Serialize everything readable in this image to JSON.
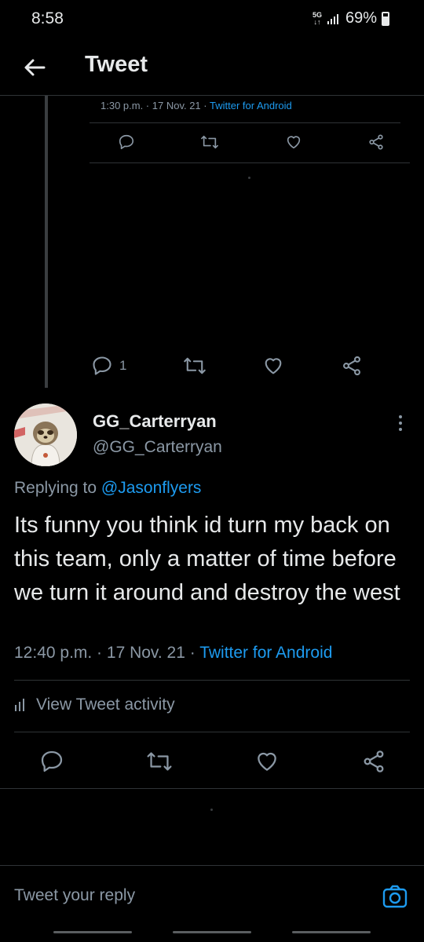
{
  "status_bar": {
    "time": "8:58",
    "network_top": "5G",
    "network_bottom": "↓↑",
    "battery": "69%"
  },
  "header": {
    "back_icon": "back-arrow-icon",
    "title": "Tweet"
  },
  "quoted_tweet": {
    "meta_prefix": "1:30 p.m. · 17 Nov. 21 · ",
    "source": "Twitter for Android",
    "actions": [
      "reply-icon",
      "retweet-icon",
      "like-icon",
      "share-icon"
    ]
  },
  "parent_actions": {
    "reply_count": "1",
    "icons": [
      "reply-icon",
      "retweet-icon",
      "like-icon",
      "share-icon"
    ]
  },
  "main_tweet": {
    "display_name": "GG_Carterryan",
    "handle": "@GG_Carterryan",
    "replying_prefix": "Replying to ",
    "replying_to": "@Jasonflyers",
    "text": "Its funny you think id turn my back on this team, only a matter of time before we turn it around and destroy the west",
    "meta_prefix": "12:40 p.m. · 17 Nov. 21 · ",
    "source": "Twitter for Android",
    "activity_label": "View Tweet activity",
    "actions": [
      "reply-icon",
      "retweet-icon",
      "like-icon",
      "share-icon"
    ]
  },
  "reply_bar": {
    "placeholder": "Tweet your reply",
    "camera_icon": "camera-icon"
  },
  "colors": {
    "background": "#000000",
    "accent": "#1d9bf0",
    "muted": "#8b98a5",
    "divider": "#2f3336"
  }
}
